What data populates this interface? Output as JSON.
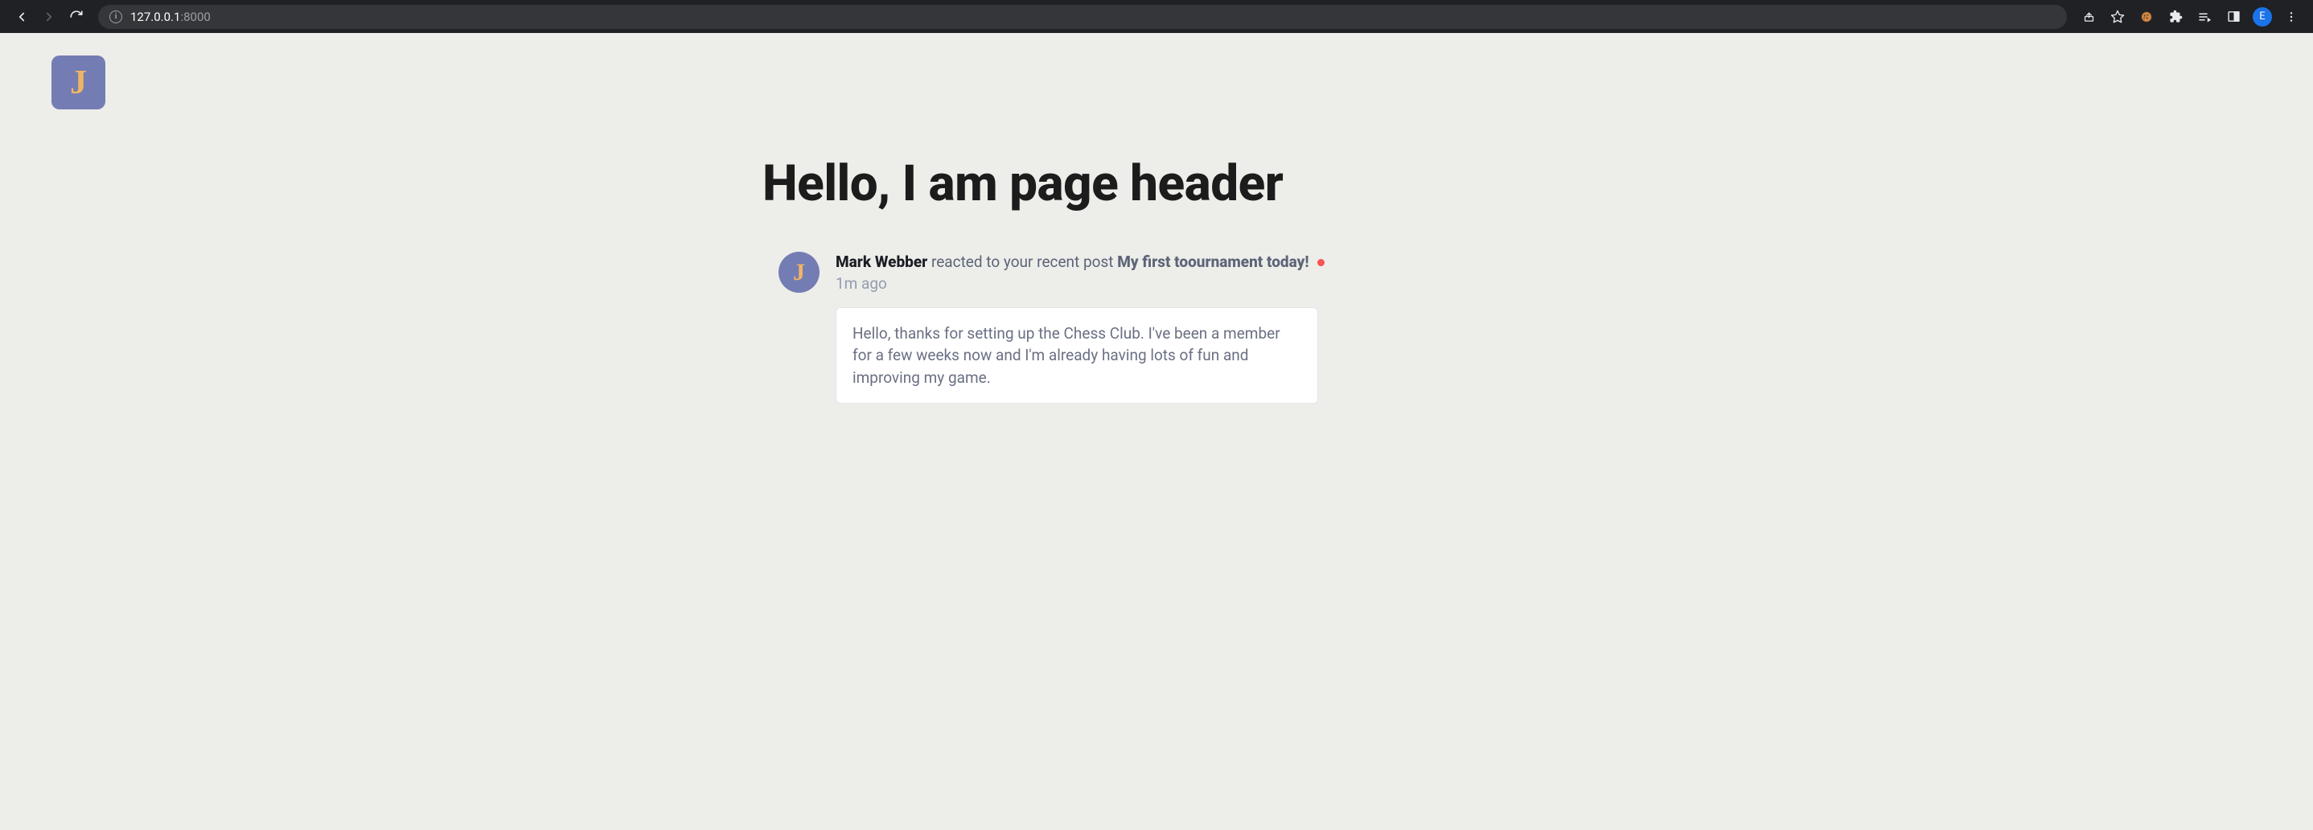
{
  "browser": {
    "url_host": "127.0.0.1",
    "url_port": ":8000",
    "profile_initial": "E"
  },
  "page": {
    "logo_letter": "J",
    "title": "Hello, I am page header"
  },
  "notification": {
    "avatar_letter": "J",
    "username": "Mark Webber",
    "action_text": " reacted to your recent post ",
    "post_title": "My first toournament today!",
    "timestamp": "1m ago",
    "message": "Hello, thanks for setting up the Chess Club. I've been a member for a few weeks now and I'm already having lots of fun and improving my game."
  }
}
